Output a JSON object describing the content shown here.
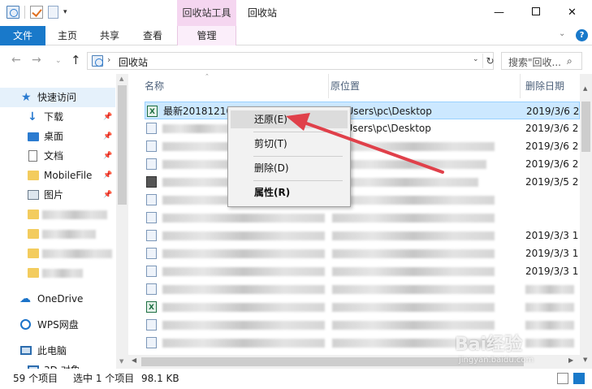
{
  "window": {
    "title": "回收站",
    "context_tab_group": "回收站工具",
    "controls": {
      "minimize": "—",
      "maximize": "",
      "close": "✕"
    }
  },
  "ribbon": {
    "tabs": [
      {
        "label": "文件",
        "active": true
      },
      {
        "label": "主页"
      },
      {
        "label": "共享"
      },
      {
        "label": "查看"
      },
      {
        "label": "管理"
      }
    ],
    "expand_glyph": "⌄",
    "help_glyph": "?"
  },
  "address_bar": {
    "back": "←",
    "forward": "→",
    "recent": "⌄",
    "up": "↑",
    "chevron": "›",
    "path": "回收站",
    "dropdown": "⌄",
    "refresh": "↻",
    "search_placeholder": "搜索\"回收...",
    "search_icon": "⌕"
  },
  "sidebar": {
    "items": [
      {
        "label": "快速访问",
        "icon": "star-icon",
        "active": true
      },
      {
        "label": "下载",
        "icon": "download-icon",
        "pinned": true
      },
      {
        "label": "桌面",
        "icon": "desktop-icon",
        "pinned": true
      },
      {
        "label": "文档",
        "icon": "document-icon",
        "pinned": true
      },
      {
        "label": "MobileFile",
        "icon": "folder-icon",
        "pinned": true
      },
      {
        "label": "图片",
        "icon": "pictures-icon",
        "pinned": true
      },
      {
        "label": "OneDrive",
        "icon": "cloud-icon"
      },
      {
        "label": "WPS网盘",
        "icon": "wps-cloud-icon"
      },
      {
        "label": "此电脑",
        "icon": "computer-icon"
      },
      {
        "label": "3D 对象",
        "icon": "3d-objects-icon"
      }
    ],
    "pin_glyph": "📌"
  },
  "columns": {
    "name": "名称",
    "original_location": "原位置",
    "date_deleted": "删除日期"
  },
  "rows": [
    {
      "name": "最新20181210",
      "original": "C:\\Users\\pc\\Desktop",
      "date": "2019/3/6 2",
      "selected": true
    },
    {
      "name": "",
      "original": "C:\\Users\\pc\\Desktop",
      "date": "2019/3/6 2"
    },
    {
      "name": "",
      "original": "",
      "date": "2019/3/6 2"
    },
    {
      "name": "",
      "original": "",
      "date": "2019/3/6 2"
    },
    {
      "name": "",
      "original": "",
      "date": "2019/3/5 2"
    },
    {
      "name": "",
      "original": "",
      "date": "2019/3/3 1"
    },
    {
      "name": "",
      "original": "",
      "date": "2019/3/3 1"
    },
    {
      "name": "",
      "original": "",
      "date": "2019/3/3 1"
    }
  ],
  "context_menu": {
    "items": [
      {
        "label": "还原(E)",
        "hover": true
      },
      {
        "label": "剪切(T)"
      },
      {
        "label": "删除(D)"
      },
      {
        "label": "属性(R)",
        "bold": true
      }
    ]
  },
  "status": {
    "count": "59 个项目",
    "selection": "选中 1 个项目",
    "size": "98.1 KB"
  },
  "watermark": {
    "logo": "Bai经验",
    "sub": "jingyan.baidu.com"
  },
  "colors": {
    "accent": "#1979ca",
    "context_tab": "#f5d6f0",
    "selection": "#cce8ff",
    "arrow": "#e0404a"
  }
}
